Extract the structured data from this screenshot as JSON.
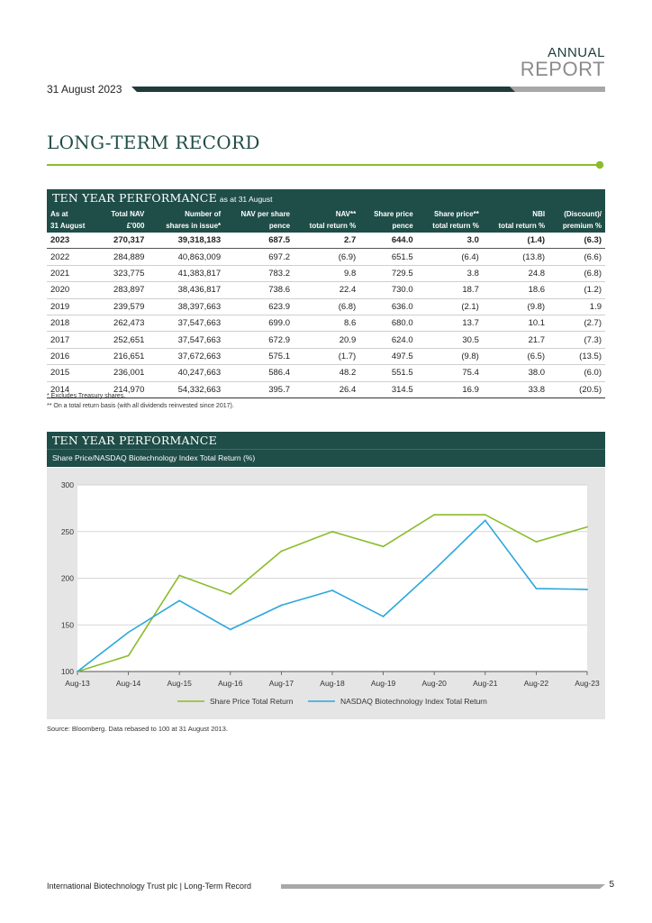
{
  "header": {
    "annual": "ANNUAL",
    "report": "REPORT",
    "date": "31 August 2023"
  },
  "page_title": "LONG-TERM RECORD",
  "performance_table": {
    "title": "TEN YEAR PERFORMANCE",
    "subtitle": "as at 31 August",
    "columns": [
      [
        "As at",
        "31 August"
      ],
      [
        "Total NAV",
        "£'000"
      ],
      [
        "Number of",
        "shares in issue*"
      ],
      [
        "NAV per share",
        "pence"
      ],
      [
        "NAV**",
        "total return %"
      ],
      [
        "Share price",
        "pence"
      ],
      [
        "Share price**",
        "total return %"
      ],
      [
        "NBI",
        "total return %"
      ],
      [
        "(Discount)/",
        "premium %"
      ]
    ],
    "rows": [
      [
        "2023",
        "270,317",
        "39,318,183",
        "687.5",
        "2.7",
        "644.0",
        "3.0",
        "(1.4)",
        "(6.3)"
      ],
      [
        "2022",
        "284,889",
        "40,863,009",
        "697.2",
        "(6.9)",
        "651.5",
        "(6.4)",
        "(13.8)",
        "(6.6)"
      ],
      [
        "2021",
        "323,775",
        "41,383,817",
        "783.2",
        "9.8",
        "729.5",
        "3.8",
        "24.8",
        "(6.8)"
      ],
      [
        "2020",
        "283,897",
        "38,436,817",
        "738.6",
        "22.4",
        "730.0",
        "18.7",
        "18.6",
        "(1.2)"
      ],
      [
        "2019",
        "239,579",
        "38,397,663",
        "623.9",
        "(6.8)",
        "636.0",
        "(2.1)",
        "(9.8)",
        "1.9"
      ],
      [
        "2018",
        "262,473",
        "37,547,663",
        "699.0",
        "8.6",
        "680.0",
        "13.7",
        "10.1",
        "(2.7)"
      ],
      [
        "2017",
        "252,651",
        "37,547,663",
        "672.9",
        "20.9",
        "624.0",
        "30.5",
        "21.7",
        "(7.3)"
      ],
      [
        "2016",
        "216,651",
        "37,672,663",
        "575.1",
        "(1.7)",
        "497.5",
        "(9.8)",
        "(6.5)",
        "(13.5)"
      ],
      [
        "2015",
        "236,001",
        "40,247,663",
        "586.4",
        "48.2",
        "551.5",
        "75.4",
        "38.0",
        "(6.0)"
      ],
      [
        "2014",
        "214,970",
        "54,332,663",
        "395.7",
        "26.4",
        "314.5",
        "16.9",
        "33.8",
        "(20.5)"
      ]
    ],
    "footnote1": "* Excludes Treasury shares.",
    "footnote2": "** On a total return basis (with all dividends reinvested since 2017)."
  },
  "chart_section": {
    "title": "TEN YEAR PERFORMANCE",
    "subtitle": "Share Price/NASDAQ Biotechnology Index Total Return (%)",
    "source": "Source: Bloomberg. Data rebased to 100 at 31 August 2013."
  },
  "chart_data": {
    "type": "line",
    "x": [
      "Aug-13",
      "Aug-14",
      "Aug-15",
      "Aug-16",
      "Aug-17",
      "Aug-18",
      "Aug-19",
      "Aug-20",
      "Aug-21",
      "Aug-22",
      "Aug-23"
    ],
    "ylim": [
      100,
      300
    ],
    "yticks": [
      100,
      150,
      200,
      250,
      300
    ],
    "grid": true,
    "legend_position": "bottom",
    "series": [
      {
        "name": "Share Price Total Return",
        "color": "#8bbc2c",
        "values": [
          100,
          117,
          203,
          183,
          229,
          250,
          234,
          268,
          268,
          239,
          255
        ]
      },
      {
        "name": "NASDAQ Biotechnology Index Total Return",
        "color": "#2aa7dc",
        "values": [
          100,
          142,
          176,
          145,
          171,
          187,
          159,
          209,
          262,
          189,
          188
        ]
      }
    ]
  },
  "footer": {
    "text": "International Biotechnology Trust plc | Long-Term Record",
    "page_number": "5"
  },
  "colors": {
    "dark_green": "#1f4d48",
    "accent_green": "#8bbc2c",
    "line_blue": "#2aa7dc"
  }
}
